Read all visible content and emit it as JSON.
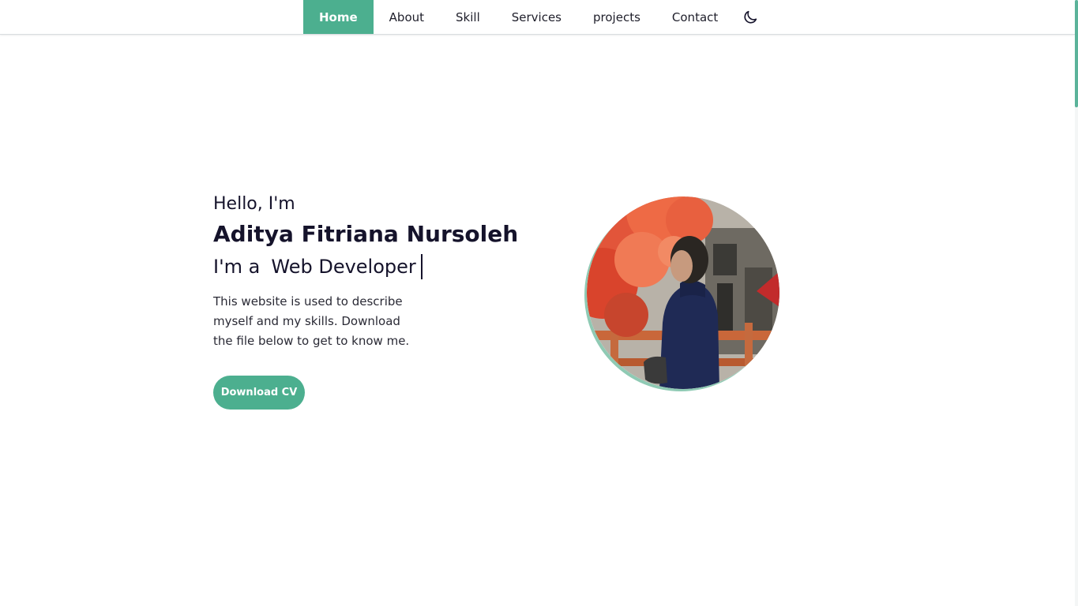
{
  "nav": {
    "items": [
      {
        "label": "Home",
        "active": true
      },
      {
        "label": "About",
        "active": false
      },
      {
        "label": "Skill",
        "active": false
      },
      {
        "label": "Services",
        "active": false
      },
      {
        "label": "projects",
        "active": false
      },
      {
        "label": "Contact",
        "active": false
      }
    ],
    "theme_toggle_icon": "moon-icon"
  },
  "hero": {
    "greeting": "Hello, I'm",
    "name": "Aditya Fitriana Nursoleh",
    "role_prefix": "I'm a",
    "role_typed": "Web Developer",
    "description": "This website is used to describe myself and my skills. Download the file below to get to know me.",
    "download_label": "Download CV",
    "photo_icon": "profile-photo"
  },
  "colors": {
    "accent": "#4caf8f",
    "text": "#15132b",
    "background": "#ffffff"
  }
}
